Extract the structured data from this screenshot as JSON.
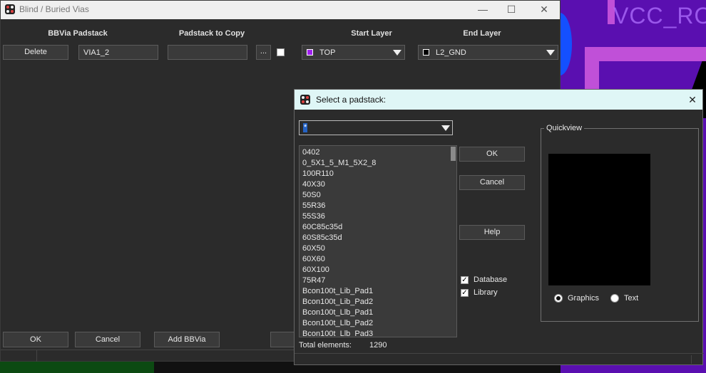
{
  "background": {
    "net_label": "VCC_RO"
  },
  "main_window": {
    "title": "Blind / Buried Vias",
    "controls": {
      "minimize": "—",
      "maximize": "☐",
      "close": "✕"
    },
    "headers": {
      "bbvia_padstack": "BBVia Padstack",
      "padstack_to_copy": "Padstack to Copy",
      "start_layer": "Start Layer",
      "end_layer": "End Layer"
    },
    "row": {
      "delete_label": "Delete",
      "bbvia_value": "VIA1_2",
      "copy_value": "",
      "browse_label": "...",
      "start_layer": {
        "value": "TOP",
        "color": "#a020f0"
      },
      "end_layer": {
        "value": "L2_GND",
        "color": "#000000"
      }
    },
    "footer": {
      "ok_label": "OK",
      "cancel_label": "Cancel",
      "add_label": "Add BBVia"
    }
  },
  "padstack_dialog": {
    "title": "Select a padstack:",
    "close": "✕",
    "filter_value": "*",
    "items": [
      "0402",
      "0_5X1_5_M1_5X2_8",
      "100R110",
      "40X30",
      "50S0",
      "55R36",
      "55S36",
      "60C85c35d",
      "60S85c35d",
      "60X50",
      "60X60",
      "60X100",
      "75R47",
      "Bcon100t_Lib_Pad1",
      "Bcon100t_Lib_Pad2",
      "Bcon100t_Llb_Pad1",
      "Bcon100t_Llb_Pad2",
      "Bcon100t_Llb_Pad3"
    ],
    "ok_label": "OK",
    "cancel_label": "Cancel",
    "help_label": "Help",
    "database_label": "Database",
    "database_checked": true,
    "library_label": "Library",
    "library_checked": true,
    "quickview_label": "Quickview",
    "graphics_label": "Graphics",
    "text_label": "Text",
    "view_mode": "Graphics",
    "total_label": "Total elements:",
    "total_value": "1290"
  }
}
